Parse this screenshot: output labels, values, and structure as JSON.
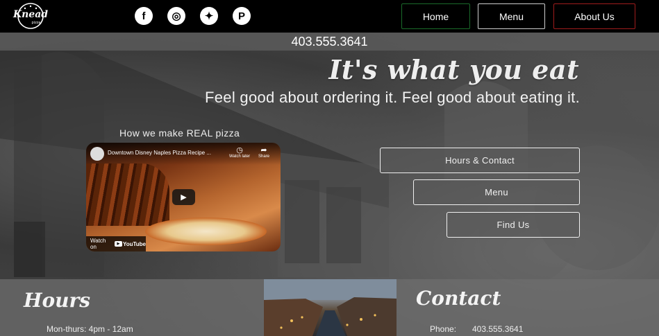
{
  "brand": {
    "logo_text": "Knead",
    "logo_subtext": "pizza"
  },
  "social": [
    {
      "icon": "facebook-icon",
      "glyph": "f"
    },
    {
      "icon": "instagram-icon",
      "glyph": "◎"
    },
    {
      "icon": "twitter-icon",
      "glyph": "✦"
    },
    {
      "icon": "pinterest-icon",
      "glyph": "P"
    }
  ],
  "nav": {
    "home": "Home",
    "menu": "Menu",
    "about": "About Us"
  },
  "colors": {
    "home_border": "#1a6b2a",
    "about_border": "#a01c1c"
  },
  "phone": "403.555.3641",
  "hero": {
    "headline": "It's what you eat",
    "subheadline": "Feel good about ordering it. Feel good about eating it."
  },
  "video": {
    "caption": "How we make REAL pizza",
    "title": "Downtown Disney Naples Pizza Recipe ...",
    "watch_later": "Watch later",
    "share": "Share",
    "watch_on": "Watch on",
    "youtube": "YouTube"
  },
  "side_buttons": {
    "hours_contact": "Hours & Contact",
    "menu": "Menu",
    "find_us": "Find Us"
  },
  "hours": {
    "title": "Hours",
    "line1": "Mon-thurs: 4pm - 12am"
  },
  "contact": {
    "title": "Contact",
    "phone_label": "Phone:",
    "phone_value": "403.555.3641"
  }
}
